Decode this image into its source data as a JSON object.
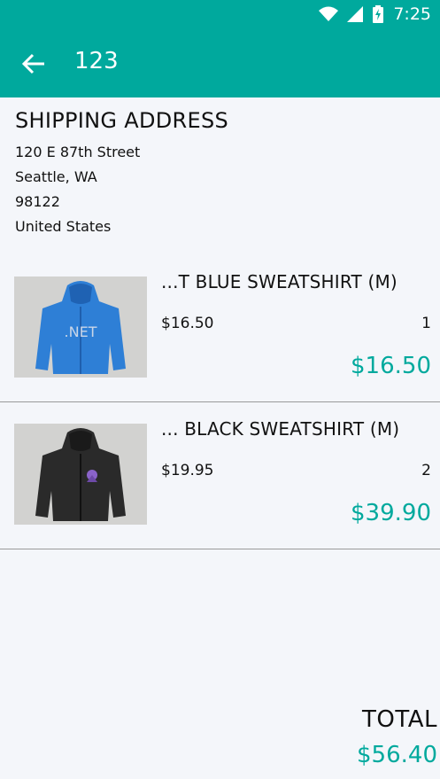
{
  "status_bar": {
    "time": "7:25"
  },
  "header": {
    "title": "123"
  },
  "shipping": {
    "heading": "SHIPPING ADDRESS",
    "street": "120 E 87th Street",
    "city_state": "Seattle, WA",
    "zip": "98122",
    "country": "United States"
  },
  "items": [
    {
      "name": "...T BLUE SWEATSHIRT (M)",
      "price": "$16.50",
      "qty": "1",
      "line_total": "$16.50",
      "image": "blue-net-hoodie"
    },
    {
      "name": "... BLACK SWEATSHIRT (M)",
      "price": "$19.95",
      "qty": "2",
      "line_total": "$39.90",
      "image": "black-hoodie"
    }
  ],
  "summary": {
    "total_label": "TOTAL",
    "total_value": "$56.40"
  },
  "colors": {
    "primary": "#00a99d"
  }
}
